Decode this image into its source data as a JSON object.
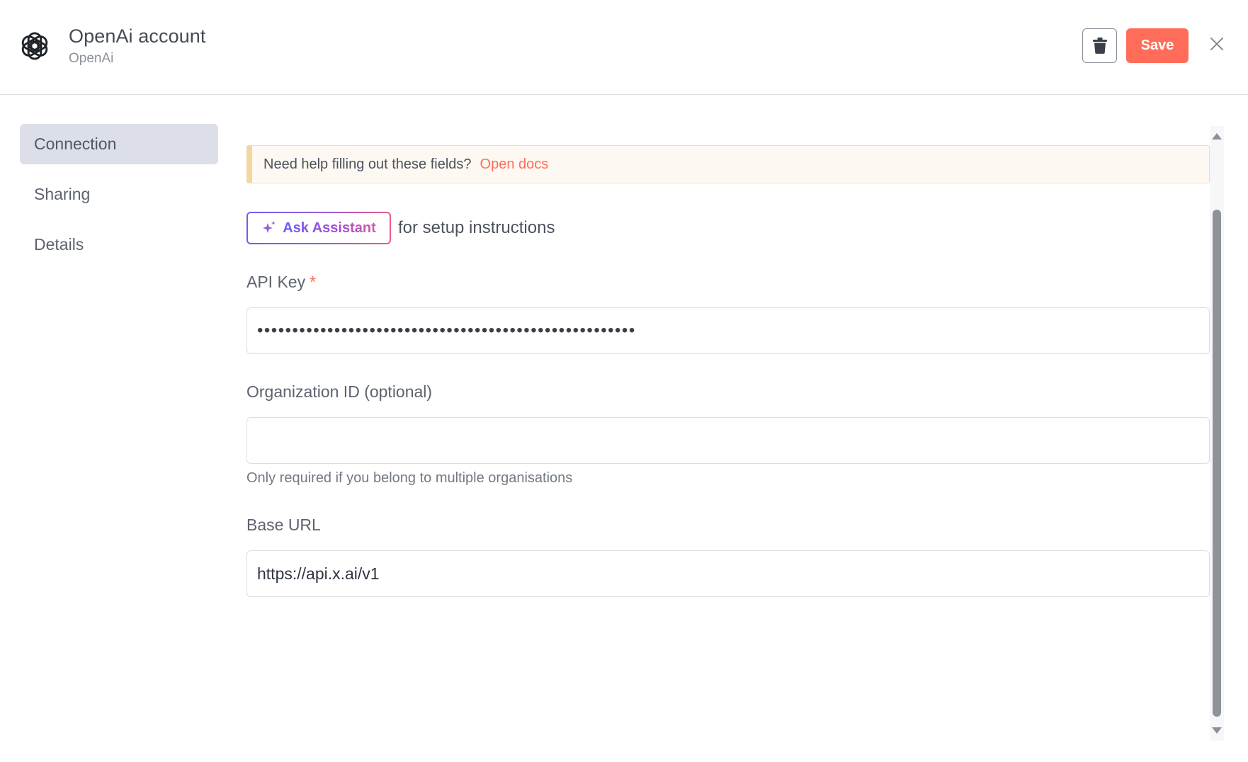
{
  "header": {
    "title": "OpenAi account",
    "subtitle": "OpenAi",
    "save_label": "Save",
    "logo_icon": "openai-logo-icon",
    "delete_icon": "trash-icon",
    "close_icon": "close-icon"
  },
  "sidebar": {
    "items": [
      {
        "label": "Connection",
        "active": true
      },
      {
        "label": "Sharing",
        "active": false
      },
      {
        "label": "Details",
        "active": false
      }
    ]
  },
  "main": {
    "help": {
      "text": "Need help filling out these fields?",
      "link_label": "Open docs"
    },
    "assistant": {
      "button_label": "Ask Assistant",
      "suffix": "for setup instructions",
      "icon": "sparkle-icon"
    },
    "fields": {
      "api_key": {
        "label": "API Key",
        "required_mark": "*",
        "value": "••••••••••••••••••••••••••••••••••••••••••••••••••••••"
      },
      "organization_id": {
        "label": "Organization ID (optional)",
        "value": "",
        "hint": "Only required if you belong to multiple organisations"
      },
      "base_url": {
        "label": "Base URL",
        "value": "https://api.x.ai/v1"
      }
    }
  },
  "colors": {
    "accent": "#ff6d5a",
    "nav_active_bg": "#dcdfe8",
    "banner_bg": "#fdf8f1",
    "banner_border": "#f2d79e",
    "assistant_gradient_start": "#6a5ff0",
    "assistant_gradient_end": "#e85a8c"
  }
}
